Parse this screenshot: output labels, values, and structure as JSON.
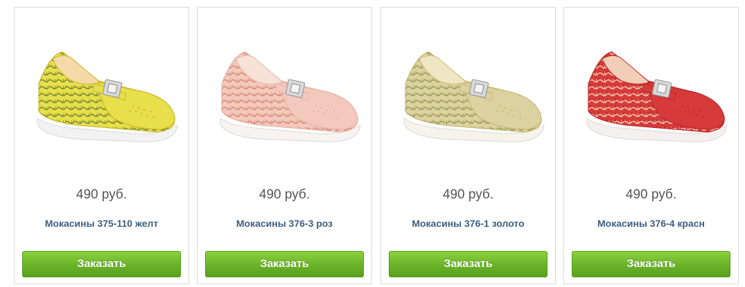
{
  "products": [
    {
      "price": "490 руб.",
      "title": "Мокасины 375-110 желт",
      "button": "Заказать",
      "image_alt": "yellow-floral-moccasin",
      "colors": {
        "main": "#e8e04a",
        "accent": "#c9b72c",
        "pattern": "#7a8a3a",
        "sole": "#f2f2f2",
        "inner": "#f5d9a8"
      }
    },
    {
      "price": "490 руб.",
      "title": "Мокасины 376-3 роз",
      "button": "Заказать",
      "image_alt": "pink-perforated-moccasin",
      "colors": {
        "main": "#f3c9bd",
        "accent": "#e6b3a4",
        "pattern": "#d98e7a",
        "sole": "#f7f3f0",
        "inner": "#f7e2d7"
      }
    },
    {
      "price": "490 руб.",
      "title": "Мокасины 376-1 золото",
      "button": "Заказать",
      "image_alt": "gold-perforated-moccasin",
      "colors": {
        "main": "#dcd2a0",
        "accent": "#c7b877",
        "pattern": "#9aa05a",
        "sole": "#f6f4ea",
        "inner": "#efe6c4"
      }
    },
    {
      "price": "490 руб.",
      "title": "Мокасины 376-4 красн",
      "button": "Заказать",
      "image_alt": "red-perforated-moccasin",
      "colors": {
        "main": "#d63a3a",
        "accent": "#b82828",
        "pattern": "#f0c4a8",
        "sole": "#f4f0ee",
        "inner": "#f2cdb8"
      }
    }
  ]
}
